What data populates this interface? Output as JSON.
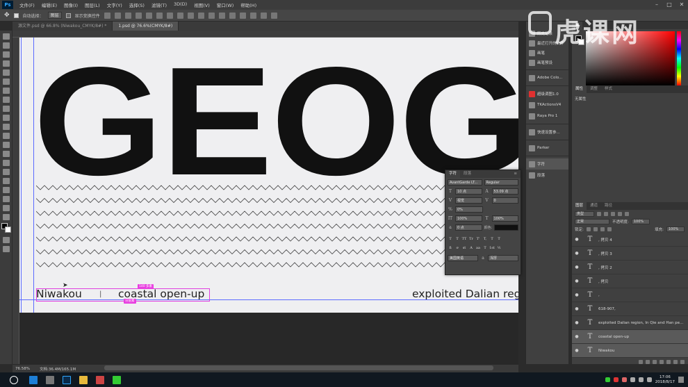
{
  "app": {
    "logo": "Ps",
    "menus": [
      "文件(F)",
      "编辑(E)",
      "图像(I)",
      "图层(L)",
      "文字(Y)",
      "选择(S)",
      "滤镜(T)",
      "3D(D)",
      "视图(V)",
      "窗口(W)",
      "帮助(H)"
    ]
  },
  "options_bar": {
    "auto_select_label": "自动选择：",
    "auto_select_value": "图层",
    "show_transform_label": "显示变换控件"
  },
  "tabs": [
    {
      "label": "源文件.psd @ 66.8% (Niwakou_CMYK/8#) *",
      "active": false
    },
    {
      "label": "1.psd @ 76.6%(CMYK/8#)",
      "active": true
    }
  ],
  "canvas": {
    "headline": "GEOGR",
    "left_text": "Niwakou",
    "separator": "|",
    "middle_text": "coastal open-up",
    "right_text": "exploited Dalian reg",
    "tag_top": "140 多素",
    "tag_bottom": "分层素",
    "zigzag_rows": 7,
    "colors": {
      "artboard": "#efeff1",
      "ink": "#111111",
      "selection": "#e040e0",
      "guide": "#5a6aff"
    }
  },
  "status": {
    "zoom": "76.58%",
    "doc": "文档:36.4M/165.1M"
  },
  "mid_panel": {
    "items": [
      {
        "label": "历史记录",
        "icon": "history-icon"
      },
      {
        "label": "最近打开的文件",
        "icon": "recent-files-icon"
      },
      {
        "label": "画笔",
        "icon": "brush-icon"
      },
      {
        "label": "画笔预设",
        "icon": "brush-preset-icon"
      },
      {
        "label": "Adobe Colo...",
        "icon": "adobe-color-icon"
      },
      {
        "label": "超级调图1.0",
        "icon": "plugin-icon"
      },
      {
        "label": "TKActionsV4",
        "icon": "tk-actions-icon"
      },
      {
        "label": "Raya Pro 1",
        "icon": "raya-pro-icon"
      },
      {
        "label": "快速设置参...",
        "icon": "quick-settings-icon"
      },
      {
        "label": "Parker",
        "icon": "parker-icon"
      },
      {
        "label": "字符",
        "icon": "character-icon"
      },
      {
        "label": "段落",
        "icon": "paragraph-icon"
      }
    ]
  },
  "color_panel": {
    "fg": "#000000",
    "bg": "#ffffff",
    "hue": "#ff0000"
  },
  "properties_panel": {
    "tabs": [
      "属性",
      "调整",
      "样式"
    ],
    "empty_text": "无属性"
  },
  "layers_panel": {
    "tabs": [
      "图层",
      "通道",
      "路径"
    ],
    "filter_label": "类型",
    "blend_mode": "正常",
    "opacity_label": "不透明度:",
    "opacity_value": "100%",
    "lock_label": "锁定:",
    "fill_label": "填充:",
    "fill_value": "100%",
    "layers": [
      {
        "name": ", 拷贝 4",
        "selected": false
      },
      {
        "name": ", 拷贝 3",
        "selected": false
      },
      {
        "name": ", 拷贝 2",
        "selected": false
      },
      {
        "name": ", 拷贝",
        "selected": false
      },
      {
        "name": ",",
        "selected": false
      },
      {
        "name": "618-907,",
        "selected": false
      },
      {
        "name": "exploited Dalian region, In Qie and Han pe...",
        "selected": false
      },
      {
        "name": "coastal open-up",
        "selected": true
      },
      {
        "name": "Niwakou",
        "selected": true
      }
    ]
  },
  "character_panel": {
    "tabs": [
      "字符",
      "段落"
    ],
    "font_family": "AvantGarde LT...",
    "font_style": "Regular",
    "font_size": "10 点",
    "leading": "53.09 点",
    "kerning": "视觉",
    "tracking": "0",
    "scale_pct": "0%",
    "vscale": "100%",
    "hscale": "100%",
    "baseline": "0 点",
    "color_label": "颜色:",
    "language": "美国英语",
    "aa": "浑厚",
    "style_buttons": [
      "T",
      "T",
      "TT",
      "Tr",
      "T'",
      "T,",
      "T",
      "T"
    ]
  },
  "taskbar": {
    "time": "17:06",
    "date": "2018/8/17"
  },
  "watermark": "虎课网"
}
